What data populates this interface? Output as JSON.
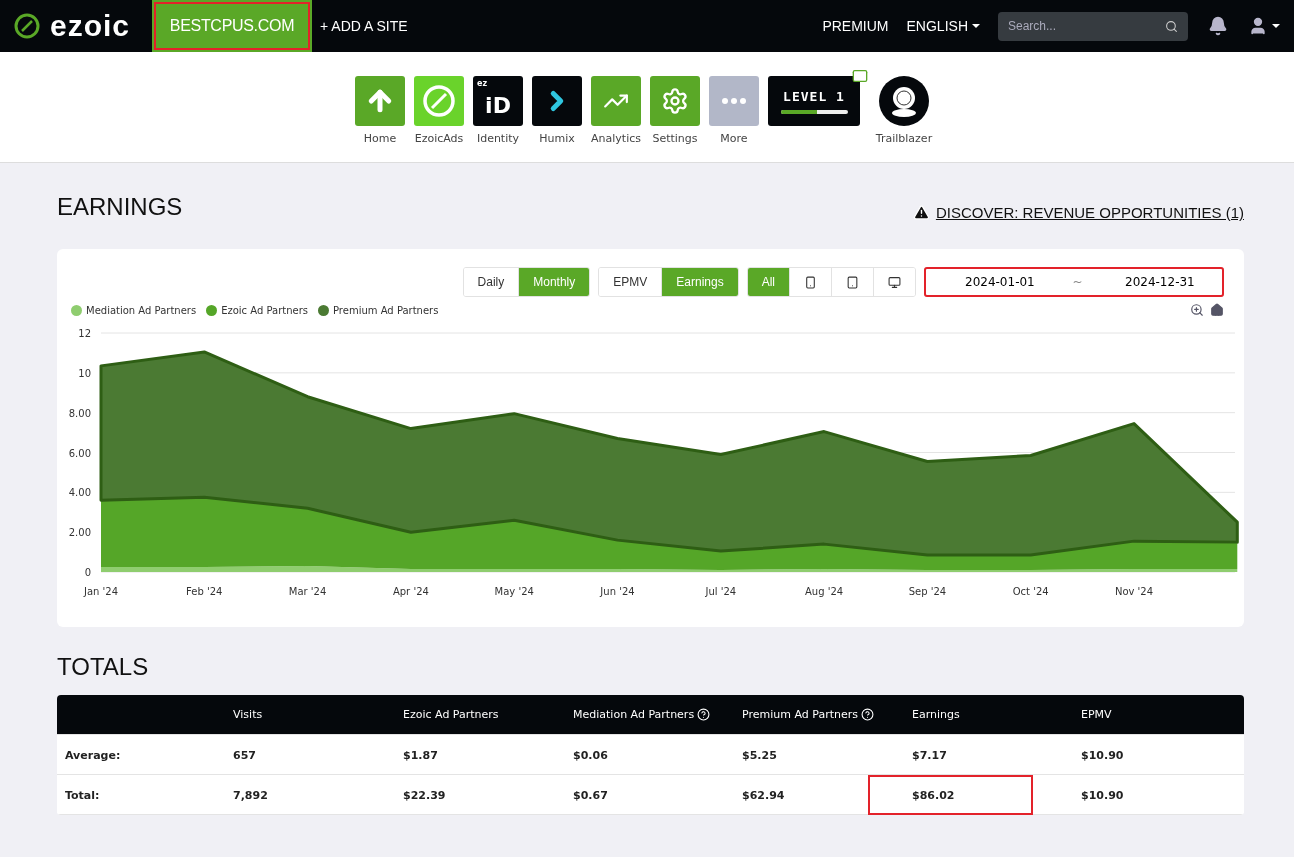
{
  "topbar": {
    "logo": "ezoic",
    "site": {
      "label": "BESTCPUS.COM",
      "highlighted": true
    },
    "add_site": "+ ADD A SITE",
    "premium": "PREMIUM",
    "language": "ENGLISH",
    "search": {
      "placeholder": "Search..."
    }
  },
  "apps": [
    {
      "kind": "home",
      "label": "Home"
    },
    {
      "kind": "ezoicads",
      "label": "EzoicAds"
    },
    {
      "kind": "identity",
      "label": "Identity",
      "badge_small": "ez",
      "badge_big": "iD"
    },
    {
      "kind": "humix",
      "label": "Humix"
    },
    {
      "kind": "analytics",
      "label": "Analytics"
    },
    {
      "kind": "settings",
      "label": "Settings"
    },
    {
      "kind": "more",
      "label": "More"
    }
  ],
  "level_badge": {
    "text": "LEVEL 1",
    "level": 0.55
  },
  "trailblazer": {
    "label": "Trailblazer"
  },
  "earnings": {
    "title": "EARNINGS",
    "discover_link": "DISCOVER: REVENUE OPPORTUNITIES (1)",
    "period": [
      {
        "label": "Daily",
        "selected": false
      },
      {
        "label": "Monthly",
        "selected": true
      }
    ],
    "metric": [
      {
        "label": "EPMV",
        "selected": false
      },
      {
        "label": "Earnings",
        "selected": true
      }
    ],
    "device": [
      {
        "kind": "text",
        "label": "All",
        "selected": true
      },
      {
        "kind": "phone",
        "selected": false
      },
      {
        "kind": "tablet",
        "selected": false
      },
      {
        "kind": "desktop",
        "selected": false
      }
    ],
    "date_range": {
      "start": "2024-01-01",
      "separator": "~",
      "end": "2024-12-31",
      "highlighted": true
    },
    "chart_data": {
      "type": "area",
      "stacked": true,
      "grid": true,
      "categories": [
        "Jan '24",
        "Feb '24",
        "Mar '24",
        "Apr '24",
        "May '24",
        "Jun '24",
        "Jul '24",
        "Aug '24",
        "Sep '24",
        "Oct '24",
        "Nov '24",
        null
      ],
      "ylim": [
        0,
        12
      ],
      "yticks": [
        {
          "value": 0,
          "label": "0"
        },
        {
          "value": 2,
          "label": "2.00"
        },
        {
          "value": 4,
          "label": "4.00"
        },
        {
          "value": 6,
          "label": "6.00"
        },
        {
          "value": 8,
          "label": "8.00"
        },
        {
          "value": 10,
          "label": "10"
        },
        {
          "value": 12,
          "label": "12"
        }
      ],
      "series": [
        {
          "name": "Mediation Ad Partners",
          "color": "#8fcd6f",
          "values": [
            0.25,
            0.25,
            0.3,
            0.15,
            0.15,
            0.15,
            0.1,
            0.15,
            0.1,
            0.1,
            0.15,
            0.15
          ]
        },
        {
          "name": "Ezoic Ad Partners",
          "color": "#55a628",
          "values": [
            3.35,
            3.5,
            2.9,
            1.85,
            2.45,
            1.45,
            0.95,
            1.25,
            0.75,
            0.75,
            1.4,
            1.35
          ]
        },
        {
          "name": "Premium Ad Partners",
          "color": "#4b7a33",
          "values": [
            6.75,
            7.3,
            5.6,
            5.2,
            5.35,
            5.1,
            4.85,
            5.65,
            4.7,
            5.0,
            5.9,
            1.0
          ]
        }
      ]
    }
  },
  "totals": {
    "title": "TOTALS",
    "columns": [
      {
        "label": "Visits",
        "help": false
      },
      {
        "label": "Ezoic Ad Partners",
        "help": false
      },
      {
        "label": "Mediation Ad Partners",
        "help": true
      },
      {
        "label": "Premium Ad Partners",
        "help": true
      },
      {
        "label": "Earnings",
        "help": false
      },
      {
        "label": "EPMV",
        "help": false
      }
    ],
    "rows": [
      {
        "label": "Average:",
        "cells": [
          {
            "text": "657",
            "highlighted": false
          },
          {
            "text": "$1.87",
            "highlighted": false
          },
          {
            "text": "$0.06",
            "highlighted": false
          },
          {
            "text": "$5.25",
            "highlighted": false
          },
          {
            "text": "$7.17",
            "highlighted": false
          },
          {
            "text": "$10.90",
            "highlighted": false
          }
        ]
      },
      {
        "label": "Total:",
        "cells": [
          {
            "text": "7,892",
            "highlighted": false
          },
          {
            "text": "$22.39",
            "highlighted": false
          },
          {
            "text": "$0.67",
            "highlighted": false
          },
          {
            "text": "$62.94",
            "highlighted": false
          },
          {
            "text": "$86.02",
            "highlighted": true
          },
          {
            "text": "$10.90",
            "highlighted": false
          }
        ]
      }
    ]
  }
}
